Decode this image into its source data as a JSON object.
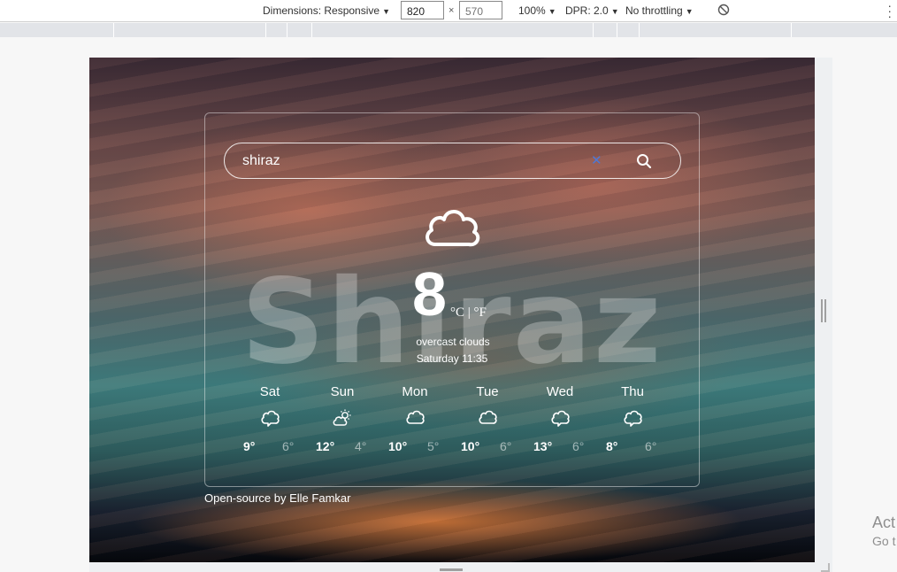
{
  "devtools": {
    "dimensions_label": "Dimensions: Responsive",
    "width_value": "820",
    "height_placeholder": "570",
    "zoom": "100%",
    "dpr": "DPR: 2.0",
    "throttling": "No throttling"
  },
  "weather": {
    "search_value": "shiraz",
    "city_watermark": "Shiraz",
    "temperature": "8",
    "units_label": "°C | °F",
    "description": "overcast clouds",
    "date": "Saturday 11:35",
    "forecast": [
      {
        "day": "Sat",
        "icon": "cloud-icon",
        "high": "9°",
        "low": "6°"
      },
      {
        "day": "Sun",
        "icon": "sun-cloud-icon",
        "high": "12°",
        "low": "4°"
      },
      {
        "day": "Mon",
        "icon": "cloud-icon",
        "high": "10°",
        "low": "5°"
      },
      {
        "day": "Tue",
        "icon": "cloud-icon",
        "high": "10°",
        "low": "6°"
      },
      {
        "day": "Wed",
        "icon": "cloud-icon",
        "high": "13°",
        "low": "6°"
      },
      {
        "day": "Thu",
        "icon": "cloud-icon",
        "high": "8°",
        "low": "6°"
      }
    ],
    "credit": "Open-source by Elle Famkar"
  },
  "os_overlay": {
    "activate_title": "Act",
    "activate_sub": "Go t"
  },
  "colors": {
    "clear_icon": "#4d78d6",
    "text": "#ffffff"
  }
}
